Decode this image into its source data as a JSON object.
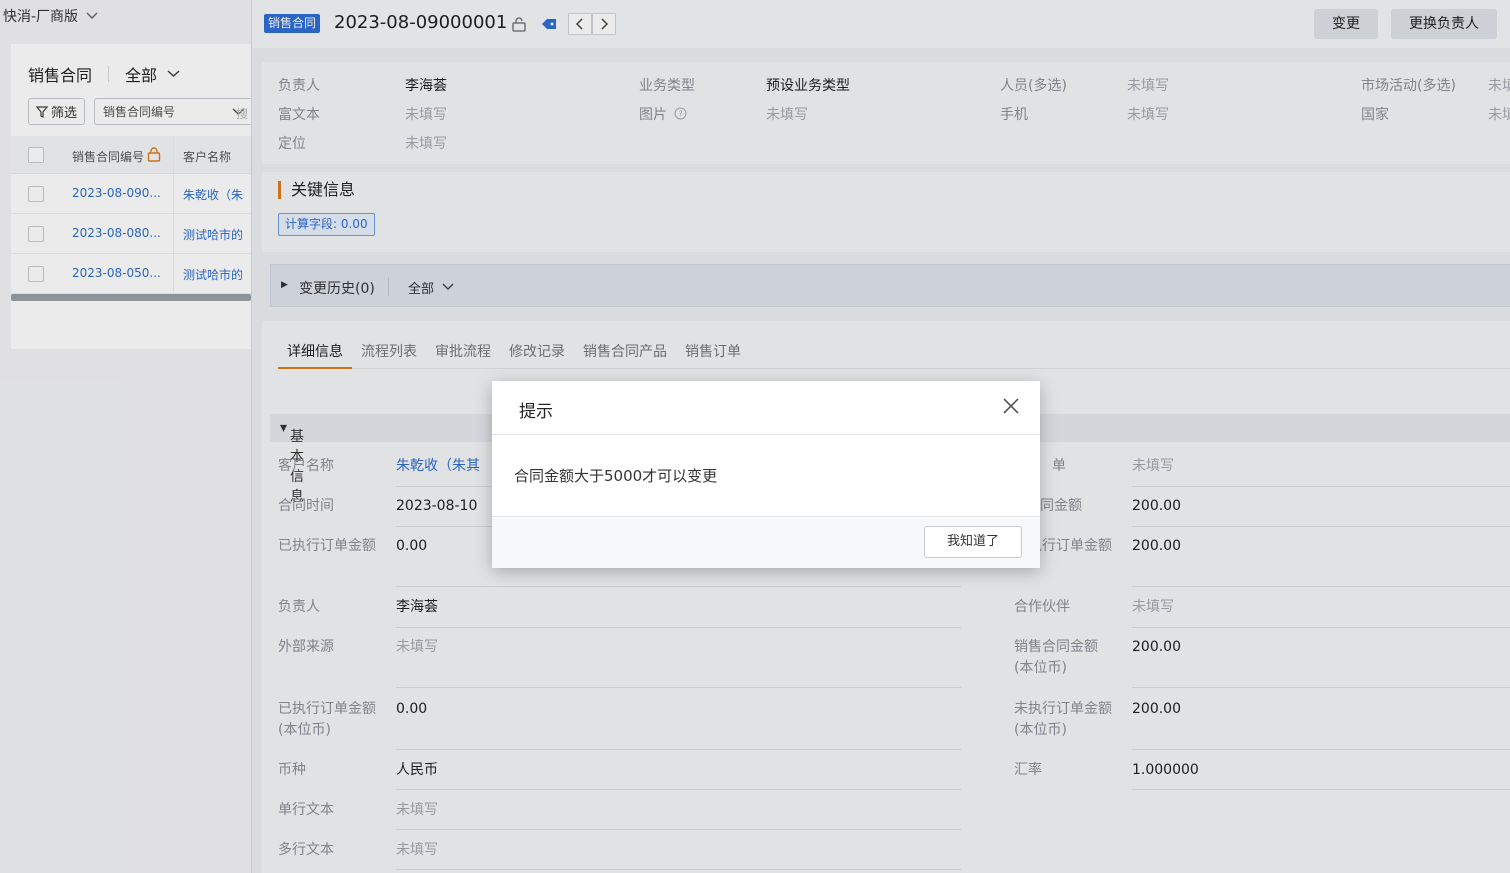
{
  "left": {
    "app_switch": "快消-厂商版",
    "object_title": "销售合同",
    "scope": "全部",
    "filter_label": "筛选",
    "field_select": "销售合同编号",
    "search_stub": "搜",
    "columns": [
      "销售合同编号",
      "客户名称"
    ],
    "rows": [
      {
        "no": "2023-08-090...",
        "customer": "朱乾收（朱"
      },
      {
        "no": "2023-08-080...",
        "customer": "测试哈市的"
      },
      {
        "no": "2023-08-050...",
        "customer": "测试哈市的"
      }
    ]
  },
  "header": {
    "object_tag": "销售合同",
    "record_no": "2023-08-09000001",
    "actions": [
      "变更",
      "更换负责人"
    ]
  },
  "summary": {
    "fields": [
      {
        "label": "负责人",
        "value": "李海荟"
      },
      {
        "label": "业务类型",
        "value": "预设业务类型"
      },
      {
        "label": "人员(多选)",
        "value": "未填写"
      },
      {
        "label": "市场活动(多选)",
        "value": "未填"
      },
      {
        "label": "富文本",
        "value": "未填写"
      },
      {
        "label": "图片",
        "value": "未填写"
      },
      {
        "label": "手机",
        "value": "未填写"
      },
      {
        "label": "国家",
        "value": "未填"
      },
      {
        "label": "定位",
        "value": "未填写"
      }
    ]
  },
  "key_info": {
    "title": "关键信息",
    "calc_field": "计算字段: 0.00"
  },
  "history": {
    "label": "变更历史(0)",
    "scope": "全部"
  },
  "tabs": [
    "详细信息",
    "流程列表",
    "审批流程",
    "修改记录",
    "销售合同产品",
    "销售订单"
  ],
  "basic": {
    "title": "基本信息",
    "left_fields": [
      {
        "label": "客户名称",
        "value": "朱乾收（朱其"
      },
      {
        "label": "合同时间",
        "value": "2023-08-10"
      },
      {
        "label": "已执行订单金额",
        "value": "0.00"
      },
      {
        "label": "负责人",
        "value": "李海荟"
      },
      {
        "label": "外部来源",
        "value": "未填写"
      },
      {
        "label": "已执行订单金额(本位币)",
        "value": "0.00"
      },
      {
        "label": "币种",
        "value": "人民币"
      },
      {
        "label": "单行文本",
        "value": "未填写"
      },
      {
        "label": "多行文本",
        "value": "未填写"
      }
    ],
    "right_fields": [
      {
        "label": "单",
        "value": "未填写"
      },
      {
        "label": "同金额",
        "value": "200.00"
      },
      {
        "label": "执行订单金额",
        "value": "200.00"
      },
      {
        "label": "合作伙伴",
        "value": "未填写"
      },
      {
        "label": "销售合同金额(本位币)",
        "value": "200.00"
      },
      {
        "label": "未执行订单金额(本位币)",
        "value": "200.00"
      },
      {
        "label": "汇率",
        "value": "1.000000"
      }
    ]
  },
  "dialog": {
    "title": "提示",
    "message": "合同金额大于5000才可以变更",
    "ok": "我知道了"
  }
}
